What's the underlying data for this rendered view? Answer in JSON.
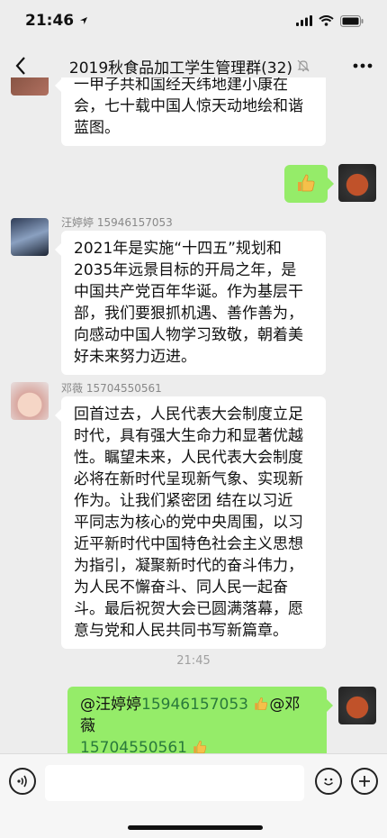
{
  "status": {
    "time": "21:46"
  },
  "nav": {
    "back_label": "<",
    "title": "2019秋食品加工学生管理群(32)",
    "more_label": "•••"
  },
  "messages": [
    {
      "type": "in",
      "lines": [
        "一甲子共和国经天纬地建小康在",
        "会，七十载中国人惊天动地绘和谐",
        "蓝图。"
      ]
    },
    {
      "type": "out",
      "emoji": "thumbs-up"
    },
    {
      "type": "in",
      "sender": "汪婷婷 15946157053",
      "lines": [
        "2021年是实施“十四五”规划和",
        "2035年远景目标的开局之年，是",
        "中国共产党百年华诞。作为基层干",
        "部，我们要狠抓机遇、善作善为，",
        "向感动中国人物学习致敬，朝着美",
        "好未来努力迈进。"
      ]
    },
    {
      "type": "in",
      "sender": "邓薇 15704550561",
      "lines": [
        "回首过去，人民代表大会制度立足",
        "时代，具有强大生命力和显著优越",
        "性。瞩望未来，人民代表大会制度",
        "必将在新时代呈现新气象、实现新",
        "作为。让我们紧密团 结在以习近",
        "平同志为核心的党中央周围，以习",
        "近平新时代中国特色社会主义思想",
        "为指引，凝聚新时代的奋斗伟力，",
        "为人民不懈奋斗、同人民一起奋",
        "斗。最后祝贺大会已圆满落幕，愿",
        "意与党和人民共同书写新篇章。"
      ]
    },
    {
      "type": "timestamp",
      "text": "21:45"
    },
    {
      "type": "out",
      "mention1_name": "@汪婷婷",
      "mention1_phone": "15946157053",
      "mention2_name": "@邓薇",
      "mention2_phone": "15704550561"
    }
  ],
  "colors": {
    "bubble_out": "#95ec69",
    "bubble_in": "#ffffff",
    "background": "#ededed"
  },
  "icons": [
    "back-icon",
    "mute-bell-icon",
    "more-icon",
    "voice-icon",
    "emoji-icon",
    "add-icon",
    "thumbs-up-icon"
  ]
}
